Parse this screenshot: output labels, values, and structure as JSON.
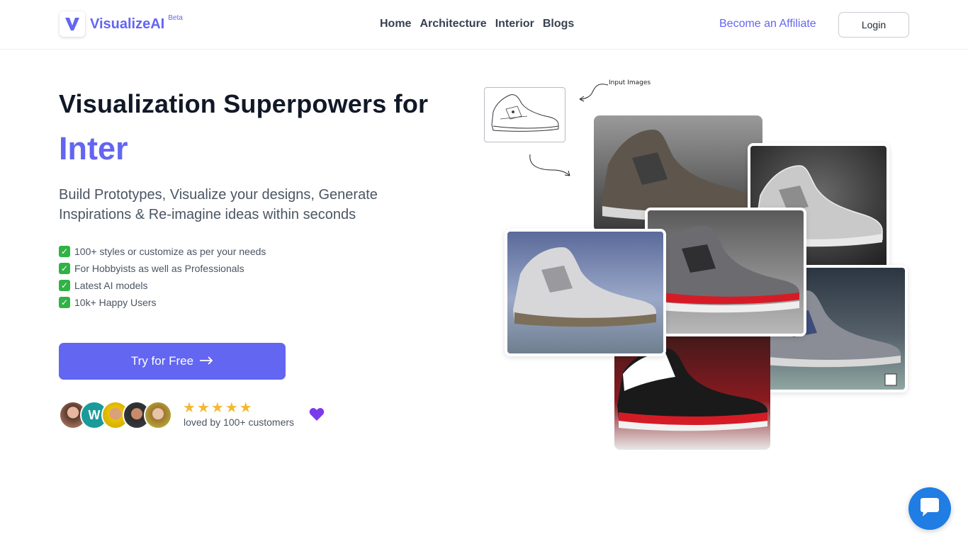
{
  "header": {
    "brand": "VisualizeAI",
    "beta_badge": "Beta",
    "nav": [
      "Home",
      "Architecture",
      "Interior",
      "Blogs"
    ],
    "affiliate_link": "Become an Affiliate",
    "login_label": "Login"
  },
  "hero": {
    "headline": "Visualization Superpowers for",
    "rotating_word": "Inter",
    "subheadline": "Build Prototypes, Visualize your designs, Generate Inspirations & Re-imagine ideas within seconds",
    "features": [
      "100+ styles or customize as per your needs",
      "For Hobbyists as well as Professionals",
      "Latest AI models",
      "10k+ Happy Users"
    ],
    "cta_label": "Try for Free",
    "cta_icon": "arrow-right-icon",
    "rating_stars": 5,
    "social_proof": "loved by 100+ customers",
    "avatar_initial": "W"
  },
  "collage": {
    "annotation": "Input Images"
  },
  "colors": {
    "accent": "#6366f1",
    "check": "#2fb344",
    "star": "#f5b82e",
    "chat": "#1f7de3",
    "heart": "#7c3aed"
  }
}
